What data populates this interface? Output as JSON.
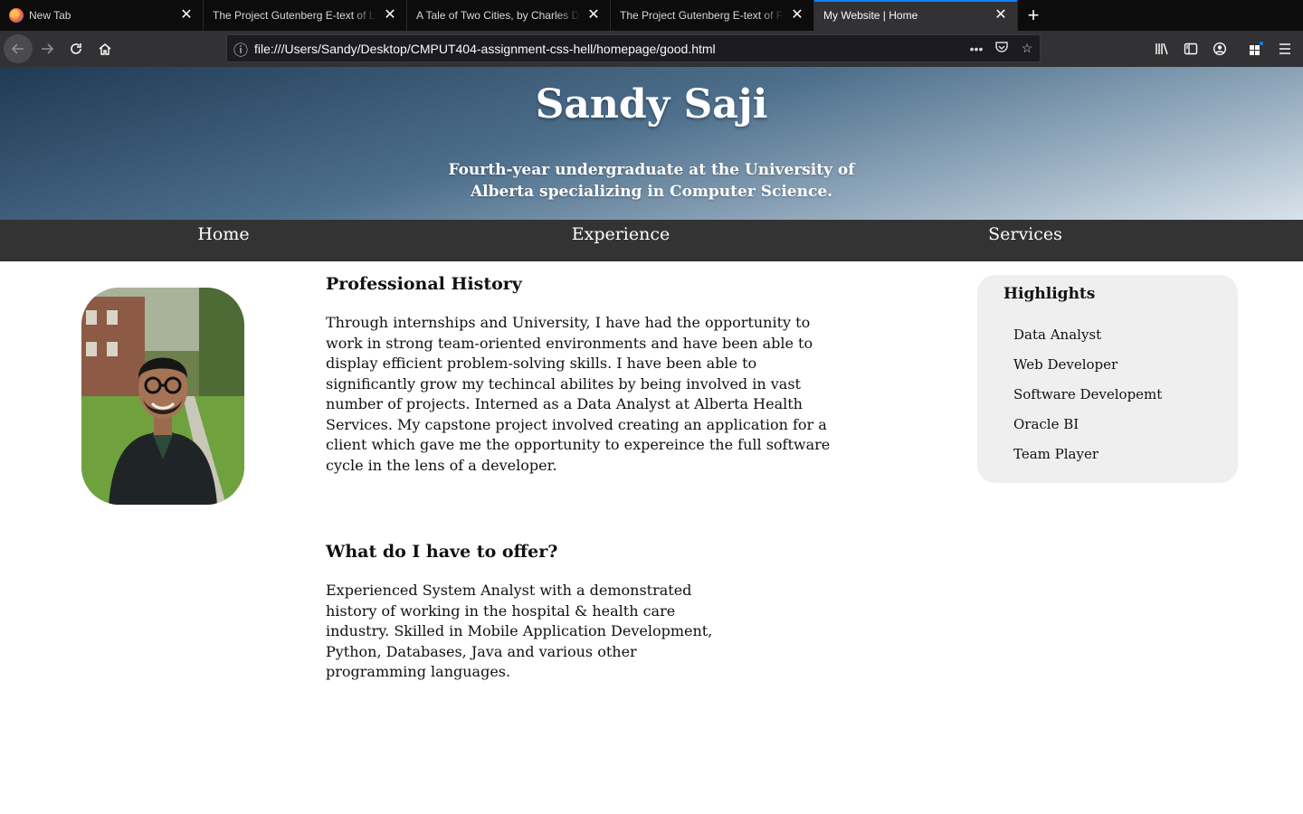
{
  "browser": {
    "tabs": [
      {
        "title": "New Tab",
        "active": false,
        "favicon": "firefox-icon"
      },
      {
        "title": "The Project Gutenberg E-text of Little Women",
        "active": false
      },
      {
        "title": "A Tale of Two Cities, by Charles Dickens",
        "active": false
      },
      {
        "title": "The Project Gutenberg E-text of Frankenstein",
        "active": false
      },
      {
        "title": "My Website | Home",
        "active": true
      }
    ],
    "url": "file:///Users/Sandy/Desktop/CMPUT404-assignment-css-hell/homepage/good.html"
  },
  "site": {
    "name": "Sandy Saji",
    "tagline": "Fourth-year undergraduate at the University of Alberta specializing in Computer Science.",
    "nav": [
      "Home",
      "Experience",
      "Services"
    ],
    "sections": [
      {
        "heading": "Professional History",
        "body": "Through internships and University, I have had the opportunity to work in strong team-oriented environments and have been able to display efficient problem-solving skills. I have been able to significantly grow my techincal abilites by being involved in vast number of projects. Interned as a Data Analyst at Alberta Health Services. My capstone project involved creating an application for a client which gave me the opportunity to expereince the full software cycle in the lens of a developer."
      },
      {
        "heading": "What do I have to offer?",
        "body": "Experienced System Analyst with a demonstrated history of working in the hospital & health care industry. Skilled in Mobile Application Development, Python, Databases, Java and various other programming languages."
      }
    ],
    "highlights": {
      "title": "Highlights",
      "items": [
        "Data Analyst",
        "Web Developer",
        "Software Developemt",
        "Oracle BI",
        "Team Player"
      ]
    }
  },
  "colors": {
    "tabbar": "#0c0c0d",
    "toolbar": "#323234",
    "active_tab_accent": "#0a84ff",
    "site_nav": "#333333",
    "highlights_bg": "#efefef"
  }
}
